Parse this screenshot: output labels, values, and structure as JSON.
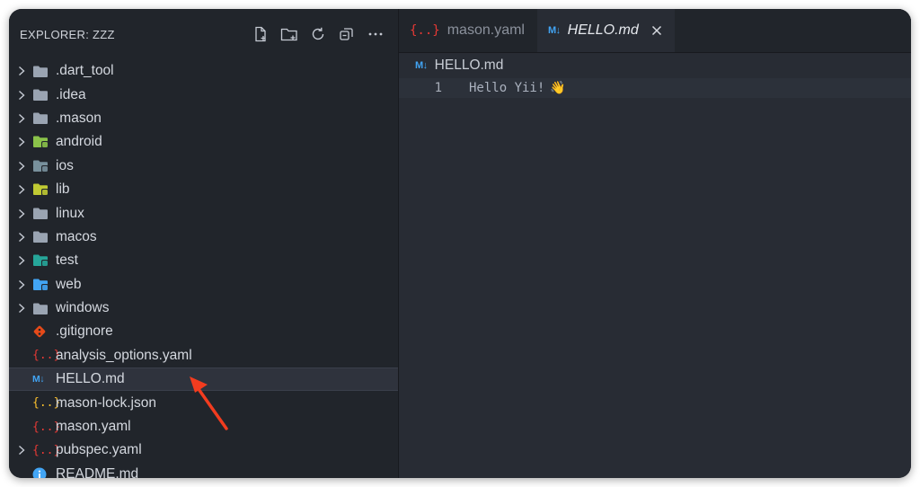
{
  "explorer": {
    "title": "EXPLORER: ZZZ",
    "actions": [
      {
        "name": "new-file-icon"
      },
      {
        "name": "new-folder-icon"
      },
      {
        "name": "refresh-icon"
      },
      {
        "name": "collapse-all-icon"
      },
      {
        "name": "more-icon"
      }
    ],
    "items": [
      {
        "label": ".dart_tool",
        "type": "folder",
        "icon": "folder-icon",
        "color": "#9aa4b2"
      },
      {
        "label": ".idea",
        "type": "folder",
        "icon": "folder-icon",
        "color": "#9aa4b2"
      },
      {
        "label": ".mason",
        "type": "folder",
        "icon": "folder-icon",
        "color": "#9aa4b2"
      },
      {
        "label": "android",
        "type": "folder",
        "icon": "folder-android-icon",
        "color": "#8bc34a"
      },
      {
        "label": "ios",
        "type": "folder",
        "icon": "folder-ios-icon",
        "color": "#78909c"
      },
      {
        "label": "lib",
        "type": "folder",
        "icon": "folder-lib-icon",
        "color": "#c0ca33"
      },
      {
        "label": "linux",
        "type": "folder",
        "icon": "folder-icon",
        "color": "#9aa4b2"
      },
      {
        "label": "macos",
        "type": "folder",
        "icon": "folder-icon",
        "color": "#9aa4b2"
      },
      {
        "label": "test",
        "type": "folder",
        "icon": "folder-test-icon",
        "color": "#26a69a"
      },
      {
        "label": "web",
        "type": "folder",
        "icon": "folder-web-icon",
        "color": "#42a5f5"
      },
      {
        "label": "windows",
        "type": "folder",
        "icon": "folder-icon",
        "color": "#9aa4b2"
      },
      {
        "label": ".gitignore",
        "type": "file",
        "icon": "git-icon",
        "color": "#e64a19"
      },
      {
        "label": "analysis_options.yaml",
        "type": "file",
        "icon": "yaml-icon",
        "color": "#e53935"
      },
      {
        "label": "HELLO.md",
        "type": "file",
        "icon": "markdown-icon",
        "color": "#42a5f5",
        "selected": true
      },
      {
        "label": "mason-lock.json",
        "type": "file",
        "icon": "json-icon",
        "color": "#fbc02d"
      },
      {
        "label": "mason.yaml",
        "type": "file",
        "icon": "yaml-icon",
        "color": "#e53935"
      },
      {
        "label": "pubspec.yaml",
        "type": "folder",
        "icon": "yaml-icon",
        "color": "#e53935"
      },
      {
        "label": "README.md",
        "type": "file",
        "icon": "info-icon",
        "color": "#42a5f5"
      }
    ]
  },
  "tabs": [
    {
      "label": "mason.yaml",
      "icon": "yaml-icon",
      "active": false
    },
    {
      "label": "HELLO.md",
      "icon": "markdown-icon",
      "active": true
    }
  ],
  "breadcrumb": {
    "label": "HELLO.md",
    "icon": "markdown-icon"
  },
  "editor": {
    "lines": [
      {
        "number": "1",
        "text": "Hello Yii!",
        "emoji": "👋"
      }
    ]
  },
  "colors": {
    "accent_arrow": "#f23c1f",
    "markdown_blue": "#42a5f5",
    "yaml_red": "#e53935"
  }
}
